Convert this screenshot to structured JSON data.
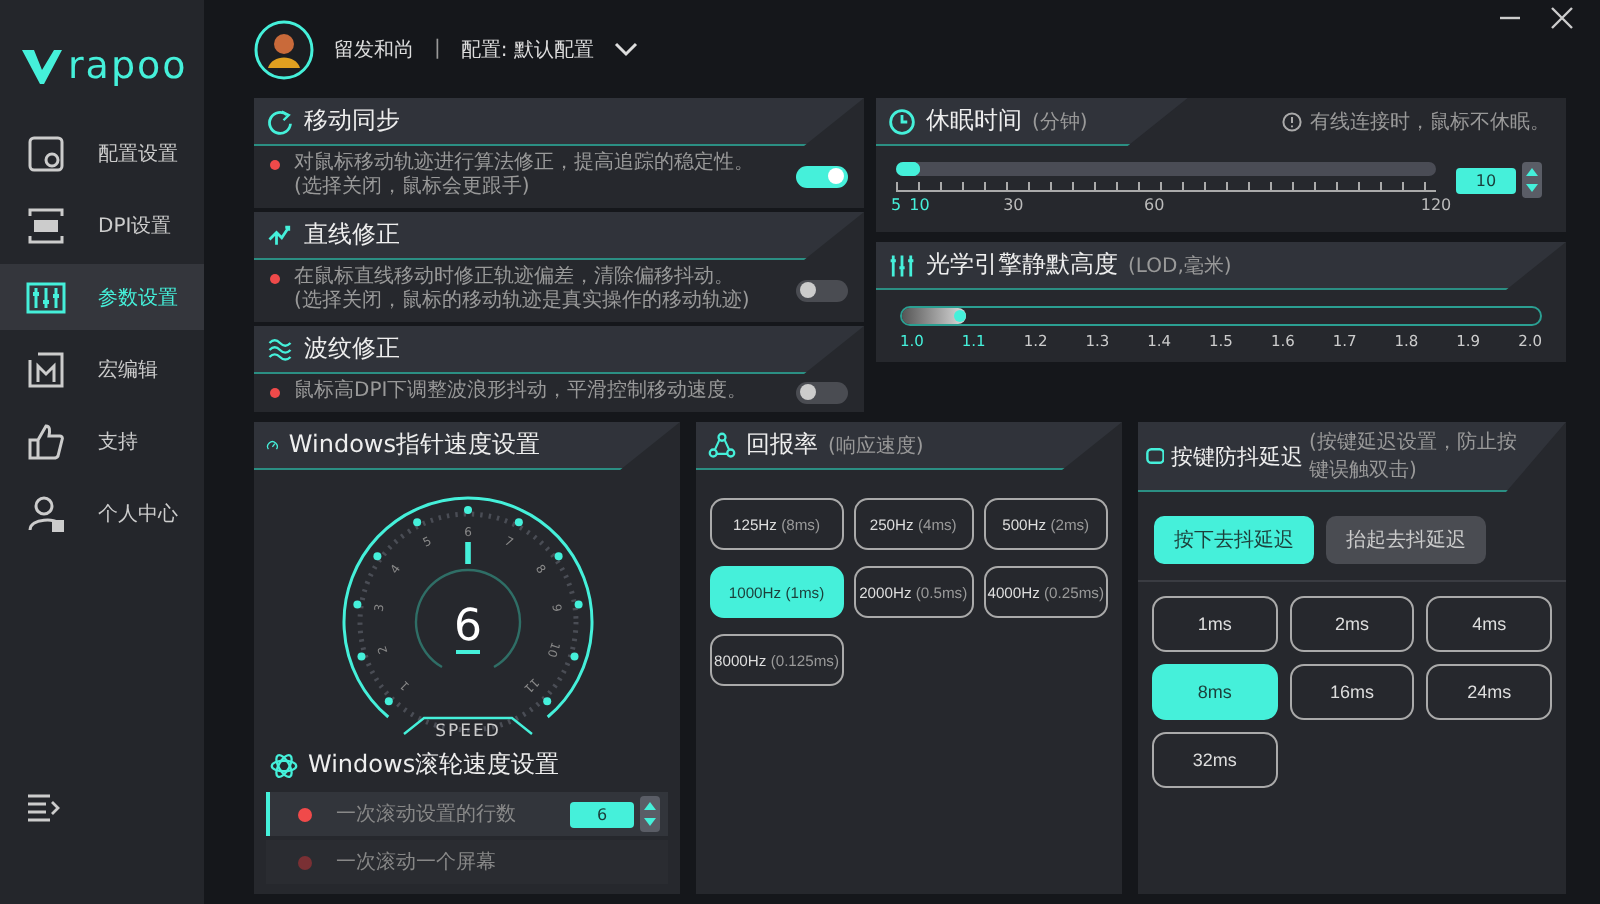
{
  "logo": "rapoo",
  "sidebar": {
    "items": [
      {
        "kind": "config",
        "label": "配置设置",
        "selected": false
      },
      {
        "kind": "dpi",
        "label": "DPI设置",
        "selected": false
      },
      {
        "kind": "params",
        "label": "参数设置",
        "selected": true
      },
      {
        "kind": "macro",
        "label": "宏编辑",
        "selected": false
      },
      {
        "kind": "support",
        "label": "支持",
        "selected": false
      },
      {
        "kind": "user",
        "label": "个人中心",
        "selected": false
      }
    ]
  },
  "header": {
    "user": "留发和尚",
    "separator": "|",
    "profile": "配置: 默认配置"
  },
  "features": [
    {
      "kind": "sync",
      "title": "移动同步",
      "description": "对鼠标移动轨迹进行算法修正，提高追踪的稳定性。\n(选择关闭，鼠标会更跟手)",
      "on": true
    },
    {
      "kind": "straight",
      "title": "直线修正",
      "description": "在鼠标直线移动时修正轨迹偏差，清除偏移抖动。\n(选择关闭，鼠标的移动轨迹是真实操作的移动轨迹)",
      "on": false
    },
    {
      "kind": "ripple",
      "title": "波纹修正",
      "description": "鼠标高DPI下调整波浪形抖动，平滑控制移动速度。",
      "on": false
    }
  ],
  "sleep": {
    "title": "休眠时间",
    "unit": "(分钟)",
    "hint": "有线连接时，鼠标不休眠。",
    "level": 0.0435,
    "value": "10",
    "ticks": [
      "5",
      "10",
      "30",
      "60",
      "120"
    ]
  },
  "lod": {
    "title": "光学引擎静默高度",
    "unit": "(LOD,毫米)",
    "level": 0.1,
    "ticks": [
      "1.0",
      "1.1",
      "1.2",
      "1.3",
      "1.4",
      "1.5",
      "1.6",
      "1.7",
      "1.8",
      "1.9",
      "2.0"
    ]
  },
  "pointer_speed": {
    "title": "Windows指针速度设置",
    "value": "6",
    "level": 0.5,
    "label": "SPEED",
    "ticks": [
      "1",
      "2",
      "3",
      "4",
      "5",
      "6",
      "7",
      "8",
      "9",
      "10",
      "11"
    ]
  },
  "scroll_speed": {
    "title": "Windows滚轮速度设置",
    "options": [
      {
        "label": "一次滚动设置的行数",
        "selected": true,
        "value": "6"
      },
      {
        "label": "一次滚动一个屏幕",
        "selected": false
      }
    ]
  },
  "report_rate": {
    "title": "回报率",
    "unit": "(响应速度)",
    "options": [
      {
        "rate": "125Hz",
        "interval": "(8ms)",
        "selected": false
      },
      {
        "rate": "250Hz",
        "interval": "(4ms)",
        "selected": false
      },
      {
        "rate": "500Hz",
        "interval": "(2ms)",
        "selected": false
      },
      {
        "rate": "1000Hz",
        "interval": "(1ms)",
        "selected": true
      },
      {
        "rate": "2000Hz",
        "interval": "(0.5ms)",
        "selected": false
      },
      {
        "rate": "4000Hz",
        "interval": "(0.25ms)",
        "selected": false
      },
      {
        "rate": "8000Hz",
        "interval": "(0.125ms)",
        "selected": false
      }
    ]
  },
  "debounce": {
    "title": "按键防抖延迟",
    "unit": "(按键延迟设置，防止按键误触双击)",
    "modes": [
      {
        "label": "按下去抖延迟",
        "selected": true
      },
      {
        "label": "抬起去抖延迟",
        "selected": false
      }
    ],
    "options": [
      {
        "label": "1ms",
        "selected": false
      },
      {
        "label": "2ms",
        "selected": false
      },
      {
        "label": "4ms",
        "selected": false
      },
      {
        "label": "8ms",
        "selected": true
      },
      {
        "label": "16ms",
        "selected": false
      },
      {
        "label": "24ms",
        "selected": false
      },
      {
        "label": "32ms",
        "selected": false
      }
    ]
  }
}
